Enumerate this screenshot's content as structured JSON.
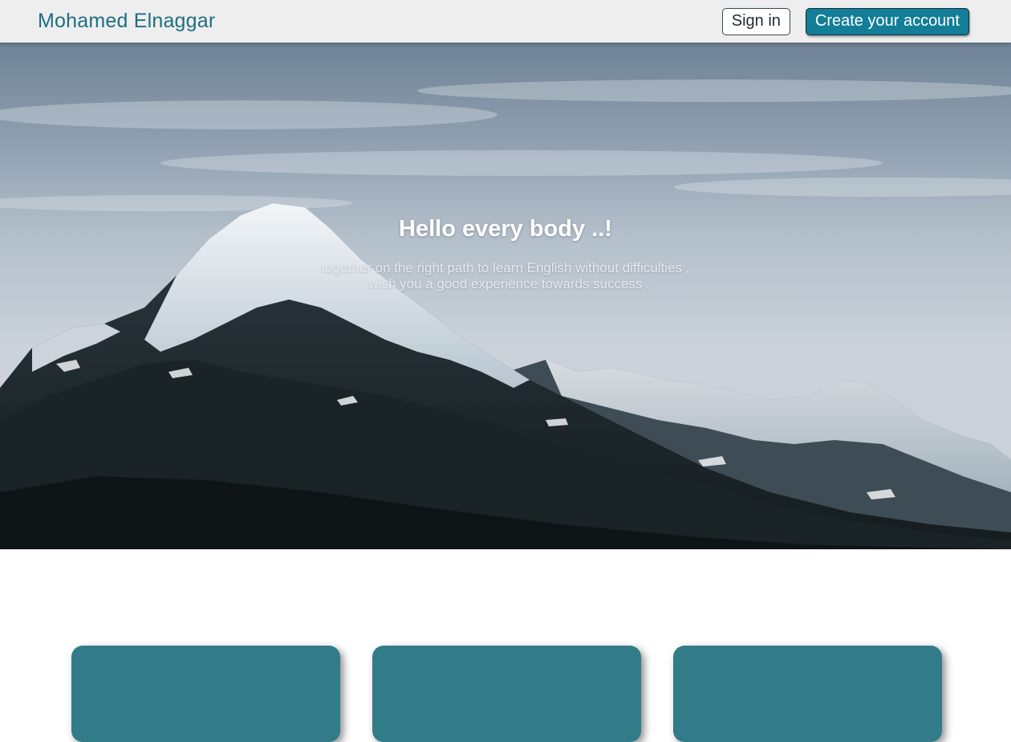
{
  "navbar": {
    "brand": "Mohamed Elnaggar",
    "sign_in_label": "Sign in",
    "create_account_label": "Create your account"
  },
  "hero": {
    "title": "Hello every body ..!",
    "subtitle_line1": "together on the right path to learn English without difficulties ,",
    "subtitle_line2": "I wish you a good experience towards success ."
  },
  "cards": [
    {
      "id": "card-1"
    },
    {
      "id": "card-2"
    },
    {
      "id": "card-3"
    }
  ],
  "colors": {
    "brand": "#1d6f80",
    "accent": "#127e97",
    "card": "#317c88",
    "navbar_bg": "#eeeeef"
  }
}
